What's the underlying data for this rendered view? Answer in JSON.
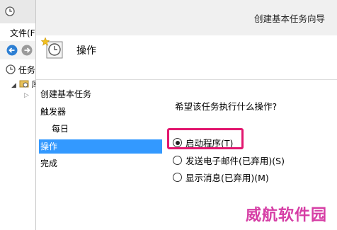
{
  "background_app": {
    "menu": "文件(F",
    "tree": [
      "任务",
      "库"
    ]
  },
  "wizard": {
    "title": "创建基本任务向导",
    "header": "操作",
    "steps": [
      {
        "label": "创建基本任务",
        "active": false
      },
      {
        "label": "触发器",
        "active": false
      },
      {
        "label": "每日",
        "active": false,
        "sub": true
      },
      {
        "label": "操作",
        "active": true
      },
      {
        "label": "完成",
        "active": false
      }
    ],
    "question": "希望该任务执行什么操作?",
    "options": [
      {
        "label": "启动程序(T)",
        "checked": true
      },
      {
        "label": "发送电子邮件(已弃用)(S)",
        "checked": false
      },
      {
        "label": "显示消息(已弃用)(M)",
        "checked": false
      }
    ]
  },
  "watermark": "威航软件园",
  "colors": {
    "selection": "#3399ff",
    "highlight": "#e2176f",
    "watermark": "#d63ea5"
  }
}
